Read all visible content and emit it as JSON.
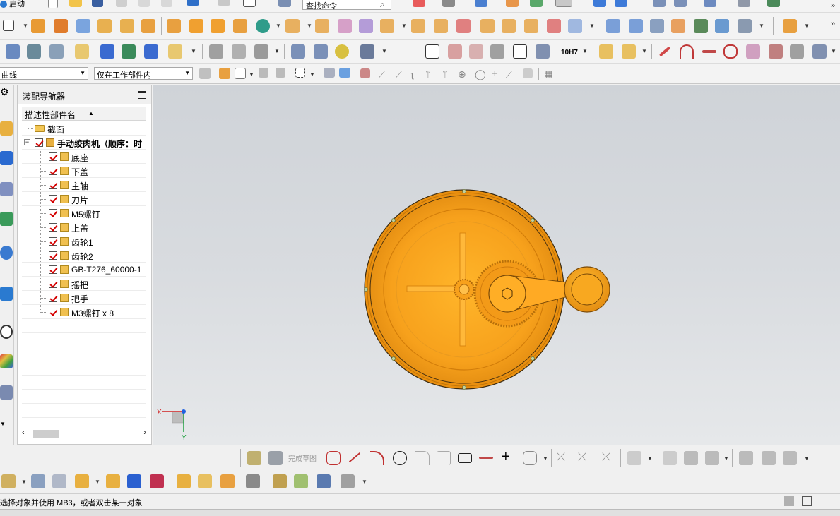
{
  "toolbar": {
    "start_label": "启动",
    "search_placeholder": "查找命令",
    "filter_type": "曲线",
    "selection_scope": "仅在工作部件内",
    "dimension_label": "10H7"
  },
  "left_rail": {
    "icons": [
      "settings-icon",
      "assembly-navigator-icon",
      "constraint-navigator-icon",
      "part-navigator-icon",
      "reuse-library-icon",
      "web-browser-icon",
      "history-icon",
      "palette-icon",
      "system-materials-icon"
    ]
  },
  "navigator": {
    "title": "装配导航器",
    "column_header": "描述性部件名",
    "items": [
      {
        "label": "截面",
        "type": "folder",
        "level": 1
      },
      {
        "label": "手动绞肉机（顺序：时",
        "type": "assembly",
        "level": 1,
        "bold": true
      },
      {
        "label": "底座",
        "type": "part",
        "level": 2
      },
      {
        "label": "下盖",
        "type": "part",
        "level": 2
      },
      {
        "label": "主轴",
        "type": "part",
        "level": 2
      },
      {
        "label": "刀片",
        "type": "part",
        "level": 2
      },
      {
        "label": "M5螺钉",
        "type": "part",
        "level": 2
      },
      {
        "label": "上盖",
        "type": "part",
        "level": 2
      },
      {
        "label": "齿轮1",
        "type": "part",
        "level": 2
      },
      {
        "label": "齿轮2",
        "type": "part",
        "level": 2
      },
      {
        "label": "GB-T276_60000-1",
        "type": "part",
        "level": 2
      },
      {
        "label": "摇把",
        "type": "part",
        "level": 2
      },
      {
        "label": "把手",
        "type": "part",
        "level": 2
      },
      {
        "label": "M3螺钉 x 8",
        "type": "part",
        "level": 2
      }
    ]
  },
  "viewport": {
    "model_color": "#f5a21b",
    "triad": {
      "x_label": "X",
      "y_label": "Y"
    }
  },
  "sketch_toolbar": {
    "finish_label": "完成草图"
  },
  "status": {
    "message": "选择对象并使用 MB3，或者双击某一对象"
  },
  "colors": {
    "accent_orange": "#f5a21b",
    "check_red": "#d40000"
  }
}
